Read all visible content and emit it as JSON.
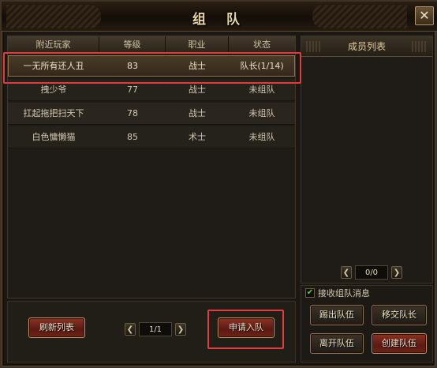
{
  "window": {
    "title": "组 队",
    "close_symbol": "✕"
  },
  "nearby": {
    "columns": [
      "附近玩家",
      "等级",
      "职业",
      "状态"
    ],
    "rows": [
      {
        "name": "一无所有还人丑",
        "level": "83",
        "class": "战士",
        "status": "队长(1/14)",
        "selected": true
      },
      {
        "name": "拽少爷",
        "level": "77",
        "class": "战士",
        "status": "未组队",
        "selected": false
      },
      {
        "name": "扛起拖把扫天下",
        "level": "78",
        "class": "战士",
        "status": "未组队",
        "selected": false
      },
      {
        "name": "白色慵懒猫",
        "level": "85",
        "class": "术士",
        "status": "未组队",
        "selected": false
      }
    ],
    "refresh_label": "刷新列表",
    "page": "1/1",
    "apply_label": "申请入队"
  },
  "members": {
    "title": "成员列表",
    "page": "0/0",
    "receive_label": "接收组队消息",
    "receive_checked": true,
    "kick_label": "踢出队伍",
    "transfer_label": "移交队长",
    "leave_label": "离开队伍",
    "create_label": "创建队伍"
  },
  "icons": {
    "prev": "chevron-left-icon",
    "next": "chevron-right-icon",
    "close": "close-icon",
    "check": "check-icon"
  },
  "colors": {
    "highlight": "#e23b3b",
    "button_red": "#8b3226",
    "gold_text": "#e8d6a4"
  }
}
